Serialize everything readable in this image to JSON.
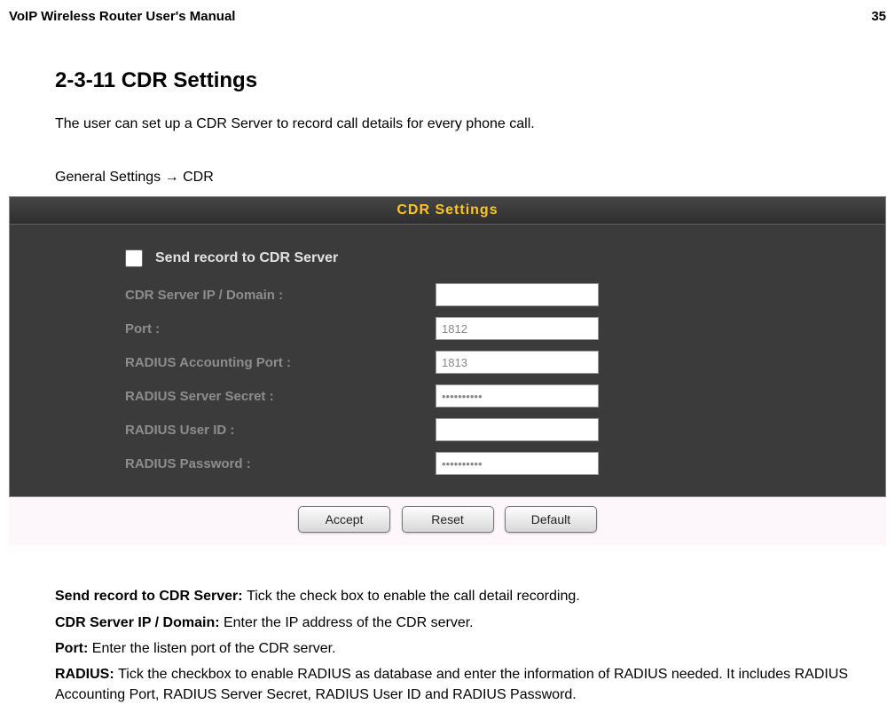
{
  "header": {
    "doc_title": "VoIP Wireless Router User's Manual",
    "page_number": "35"
  },
  "section": {
    "heading": "2-3-11 CDR Settings",
    "description": "The user can set up a CDR Server to record call details for every phone call.",
    "breadcrumb_prefix": "General Settings ",
    "breadcrumb_arrow": "→",
    "breadcrumb_suffix": " CDR"
  },
  "panel": {
    "title": "CDR Settings",
    "checkbox_label": "Send record to CDR Server",
    "checkbox_checked": false,
    "fields": {
      "cdr_server_label": "CDR Server IP / Domain :",
      "cdr_server_value": "",
      "port_label": "Port :",
      "port_value": "1812",
      "radius_acct_port_label": "RADIUS Accounting Port :",
      "radius_acct_port_value": "1813",
      "radius_secret_label": "RADIUS Server Secret :",
      "radius_secret_value": "••••••••••",
      "radius_user_label": "RADIUS User ID :",
      "radius_user_value": "",
      "radius_pass_label": "RADIUS Password :",
      "radius_pass_value": "••••••••••"
    },
    "buttons": {
      "accept": "Accept",
      "reset": "Reset",
      "default": "Default"
    }
  },
  "notes": {
    "send_record_b": "Send record to CDR Server: ",
    "send_record_t": "Tick the check box to enable the call detail recording.",
    "cdr_ip_b": "CDR Server IP / Domain: ",
    "cdr_ip_t": "Enter the IP address of the CDR server.",
    "port_b": "Port: ",
    "port_t": "Enter the listen port of the CDR server.",
    "radius_b": "RADIUS: ",
    "radius_t": "Tick the checkbox to enable RADIUS as database and enter the information of RADIUS needed. It includes RADIUS Accounting Port, RADIUS Server Secret, RADIUS User ID and RADIUS Password."
  }
}
